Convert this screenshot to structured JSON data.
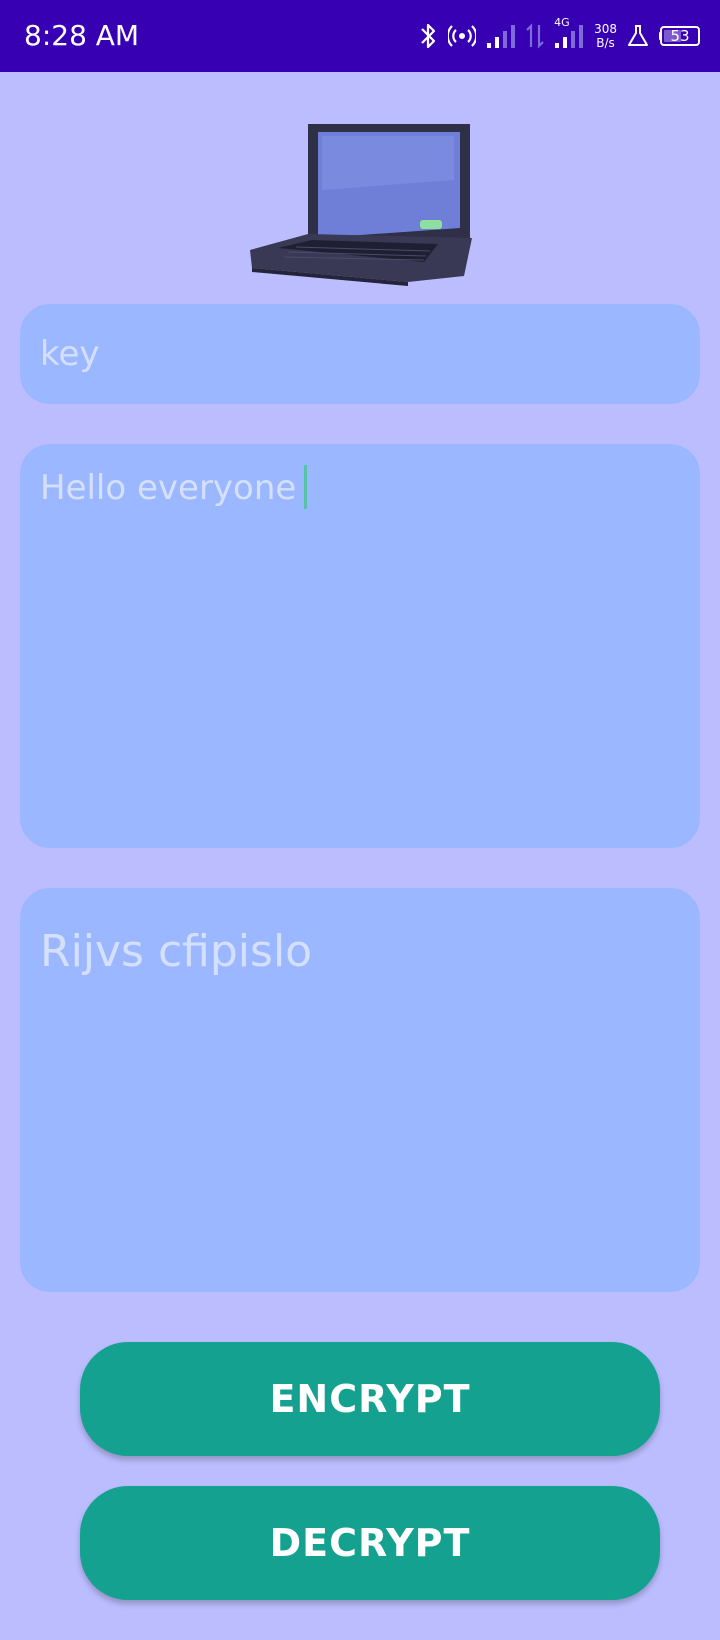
{
  "status_bar": {
    "time": "8:28 AM",
    "network_type": "4G",
    "speed_value": "308",
    "speed_unit": "B/s",
    "battery_level": "53",
    "battery_fraction": 0.53,
    "icons": [
      "bluetooth-icon",
      "hotspot-icon",
      "signal-icon",
      "data-activity-icon",
      "signal-4g-icon",
      "lab-icon",
      "battery-icon"
    ]
  },
  "header": {
    "image": "laptop-icon"
  },
  "key_input": {
    "placeholder": "key",
    "value": ""
  },
  "message_input": {
    "value": "Hello everyone"
  },
  "output": {
    "value": "Rijvs cfipislo"
  },
  "actions": {
    "encrypt_label": "ENCRYPT",
    "decrypt_label": "DECRYPT"
  },
  "colors": {
    "status_bar": "#3700b3",
    "background": "#bbbdfe",
    "field": "#9bb7ff",
    "field_text": "#d5e0ff",
    "button": "#14a190",
    "caret": "#56c2a6"
  }
}
